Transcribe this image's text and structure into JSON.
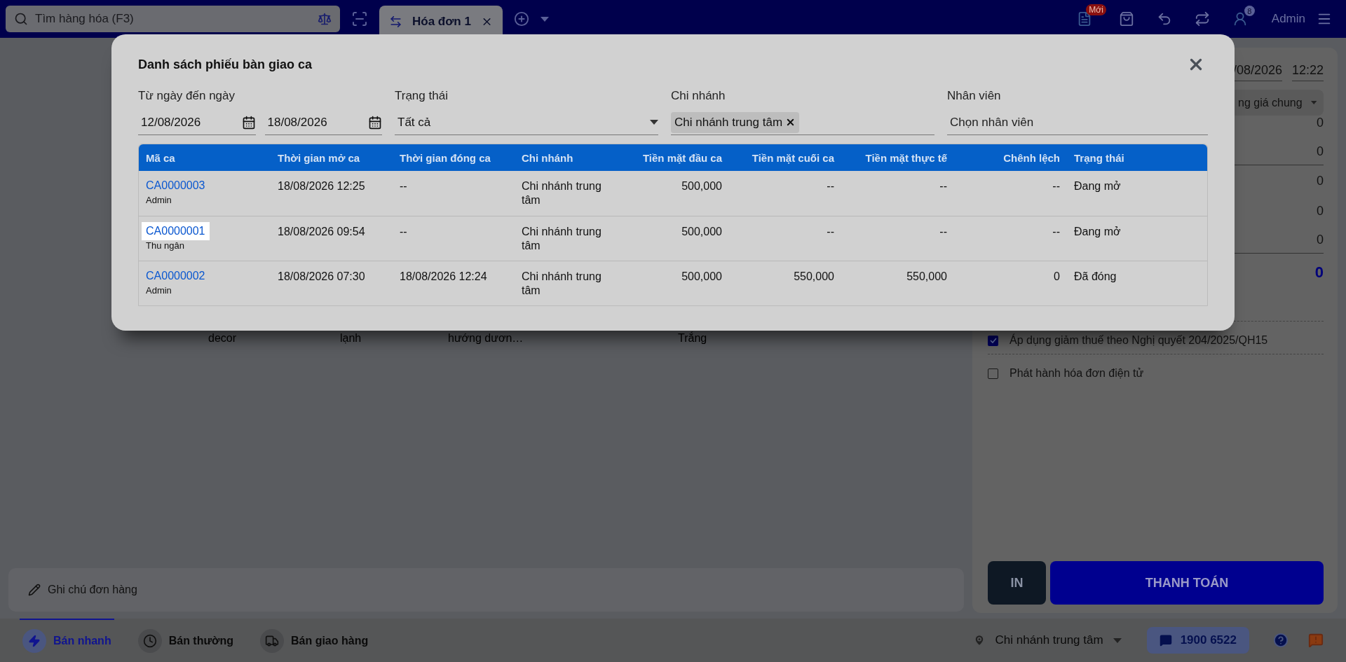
{
  "top_bar": {
    "search_placeholder": "Tìm hàng hóa (F3)",
    "tabs": [
      {
        "label": "Hóa đơn 1",
        "selected": true
      }
    ],
    "new_badge": "Mới",
    "notification_count": "8",
    "user": "Admin"
  },
  "order_row": [
    "decor",
    "lạnh",
    "hướng dươn…",
    "Trắng"
  ],
  "note_placeholder": "Ghi chú đơn hàng",
  "right_panel": {
    "date": "/08/2026",
    "time": "12:22",
    "price_list": "ng giá chung",
    "amounts": [
      "0",
      "0",
      "0",
      "0",
      "0"
    ],
    "total": "0",
    "options": [
      {
        "label": "Áp dụng giảm thuế theo Nghị quyết 204/2025/QH15",
        "checked": true
      },
      {
        "label": "Phát hành hóa đơn điện tử",
        "checked": false
      }
    ],
    "print_button": "IN",
    "pay_button": "THANH TOÁN"
  },
  "bottom_bar": {
    "modes": [
      {
        "label": "Bán nhanh",
        "kind": "quick",
        "selected": true
      },
      {
        "label": "Bán thường",
        "kind": "normal",
        "selected": false
      },
      {
        "label": "Bán giao hàng",
        "kind": "delivery",
        "selected": false
      }
    ],
    "branch": "Chi nhánh trung tâm",
    "hotline": "1900 6522"
  },
  "modal": {
    "title": "Danh sách phiếu bàn giao ca",
    "filters": {
      "date_label": "Từ ngày đến ngày",
      "date_from": "12/08/2026",
      "date_to": "18/08/2026",
      "status_label": "Trạng thái",
      "status_value": "Tất cả",
      "branch_label": "Chi nhánh",
      "branch_tags": [
        "Chi nhánh trung tâm"
      ],
      "staff_label": "Nhân viên",
      "staff_placeholder": "Chọn nhân viên"
    },
    "columns": [
      {
        "label": "Mã ca",
        "kind": "code"
      },
      {
        "label": "Thời gian mở ca",
        "kind": "text"
      },
      {
        "label": "Thời gian đóng ca",
        "kind": "text"
      },
      {
        "label": "Chi nhánh",
        "kind": "wrap"
      },
      {
        "label": "Tiền mặt đầu ca",
        "kind": "money"
      },
      {
        "label": "Tiền mặt cuối ca",
        "kind": "money"
      },
      {
        "label": "Tiền mặt thực tế",
        "kind": "money"
      },
      {
        "label": "Chênh lệch",
        "kind": "money"
      },
      {
        "label": "Trạng thái",
        "kind": "text"
      }
    ],
    "rows": [
      {
        "selected": false,
        "cells": [
          {
            "text": "CA0000003",
            "sub": "Admin"
          },
          {
            "text": "18/08/2026 12:25"
          },
          {
            "text": "--"
          },
          {
            "text": "Chi nhánh trung tâm"
          },
          {
            "text": "500,000"
          },
          {
            "text": "--"
          },
          {
            "text": "--"
          },
          {
            "text": "--"
          },
          {
            "text": "Đang mở"
          }
        ]
      },
      {
        "selected": true,
        "cells": [
          {
            "text": "CA0000001",
            "sub": "Thu ngân"
          },
          {
            "text": "18/08/2026 09:54"
          },
          {
            "text": "--"
          },
          {
            "text": "Chi nhánh trung tâm"
          },
          {
            "text": "500,000"
          },
          {
            "text": "--"
          },
          {
            "text": "--"
          },
          {
            "text": "--"
          },
          {
            "text": "Đang mở"
          }
        ]
      },
      {
        "selected": false,
        "cells": [
          {
            "text": "CA0000002",
            "sub": "Admin"
          },
          {
            "text": "18/08/2026 07:30"
          },
          {
            "text": "18/08/2026 12:24"
          },
          {
            "text": "Chi nhánh trung tâm"
          },
          {
            "text": "500,000"
          },
          {
            "text": "550,000"
          },
          {
            "text": "550,000"
          },
          {
            "text": "0"
          },
          {
            "text": "Đã đóng"
          }
        ]
      }
    ]
  }
}
